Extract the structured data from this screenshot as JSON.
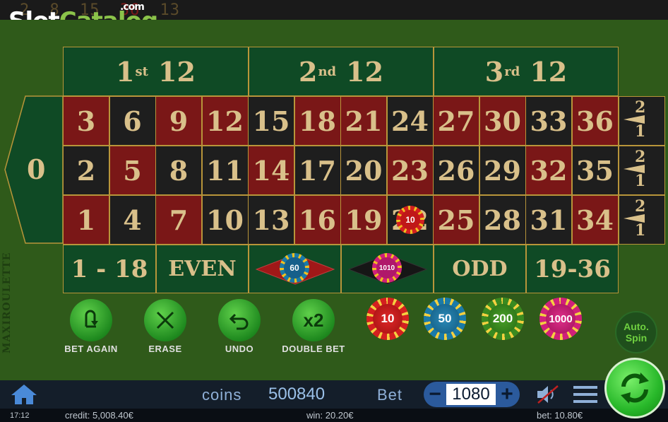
{
  "history": [
    {
      "value": "2",
      "color": "black"
    },
    {
      "value": "8",
      "color": "black"
    },
    {
      "value": "15",
      "color": "black"
    },
    {
      "value": "36",
      "color": "red"
    },
    {
      "value": "13",
      "color": "black"
    }
  ],
  "watermark": {
    "slot": "Slot",
    "catalog": "Catalog",
    "com": ".com"
  },
  "side_label": "MAXIROULETTE",
  "zero": "0",
  "dozens": [
    {
      "num": "1",
      "suffix": "st",
      "label": "12"
    },
    {
      "num": "2",
      "suffix": "nd",
      "label": "12"
    },
    {
      "num": "3",
      "suffix": "rd",
      "label": "12"
    }
  ],
  "rows": {
    "top": [
      "3",
      "6",
      "9",
      "12",
      "15",
      "18",
      "21",
      "24",
      "27",
      "30",
      "33",
      "36"
    ],
    "middle": [
      "2",
      "5",
      "8",
      "11",
      "14",
      "17",
      "20",
      "23",
      "26",
      "29",
      "32",
      "35"
    ],
    "bottom": [
      "1",
      "4",
      "7",
      "10",
      "13",
      "16",
      "19",
      "22",
      "25",
      "28",
      "31",
      "34"
    ]
  },
  "column_bet": {
    "top": "2",
    "bottom": "1"
  },
  "outside": [
    "1 - 18",
    "EVEN",
    "",
    "",
    "ODD",
    "19-36"
  ],
  "placed_chips": [
    {
      "value": "10"
    },
    {
      "value": "60"
    },
    {
      "value": "1010"
    }
  ],
  "controls": {
    "bet_again": "BET AGAIN",
    "erase": "ERASE",
    "undo": "UNDO",
    "double_bet": "DOUBLE BET",
    "double_icon": "x2"
  },
  "chip_values": [
    "10",
    "50",
    "200",
    "1000"
  ],
  "autospin": {
    "line1": "Auto.",
    "line2": "Spin"
  },
  "bottom": {
    "coins_label": "coins",
    "coins_value": "500840",
    "bet_label": "Bet",
    "bet_value": "1080",
    "minus": "−",
    "plus": "+"
  },
  "status": {
    "time": "17:12",
    "credit": "credit: 5,008.40€",
    "win": "win: 20.20€",
    "bet": "bet: 10.80€"
  },
  "colors": {
    "felt": "#2f5a1a",
    "red": "#7a1717",
    "black": "#1e1e1e",
    "green": "#0f4a25",
    "gold": "#b8953a",
    "accent_green": "#28b82a"
  }
}
